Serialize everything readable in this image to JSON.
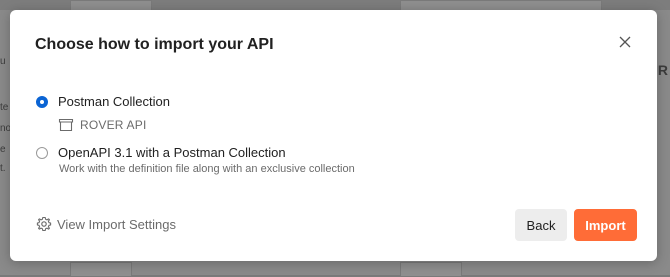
{
  "background": {
    "left_snippets": [
      "u",
      "te",
      "no",
      "e",
      "t."
    ],
    "right_snippet": "UR"
  },
  "modal": {
    "title": "Choose how to import your API",
    "close_icon": "close-icon",
    "options": [
      {
        "label": "Postman Collection",
        "selected": true,
        "sub_icon": "collection-icon",
        "sub_label": "ROVER API"
      },
      {
        "label": "OpenAPI 3.1 with a Postman Collection",
        "selected": false,
        "description": "Work with the definition file along with an exclusive collection"
      }
    ],
    "settings_link": {
      "icon": "gear-icon",
      "label": "View Import Settings"
    },
    "buttons": {
      "back": "Back",
      "import": "Import"
    },
    "colors": {
      "accent": "#ff6c37",
      "radio_selected": "#0b64d4"
    }
  }
}
